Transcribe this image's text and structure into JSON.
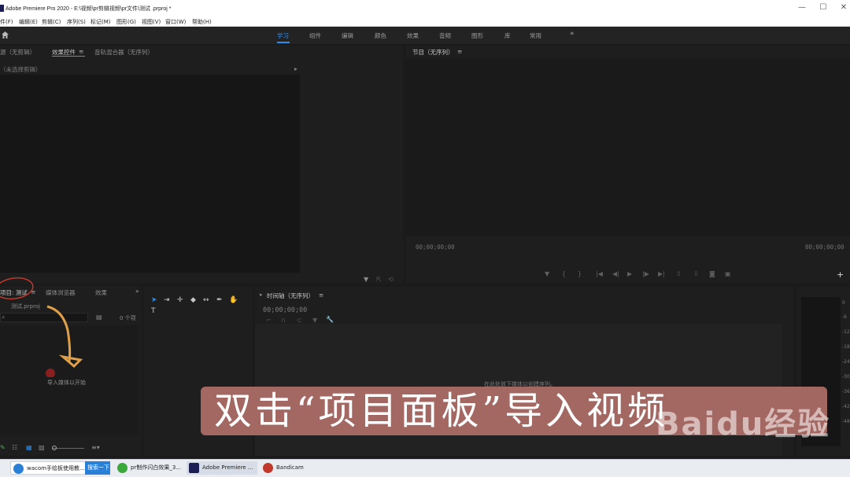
{
  "window": {
    "title": "Adobe Premiere Pro 2020 - E:\\视频\\pr剪辑视频\\pr文件\\测试 .prproj *",
    "controls": [
      "—",
      "☐",
      "✕"
    ]
  },
  "menu": [
    "件(F)",
    "编辑(E)",
    "剪辑(C)",
    "序列(S)",
    "标记(M)",
    "图形(G)",
    "视图(V)",
    "窗口(W)",
    "帮助(H)"
  ],
  "workspaces": {
    "tabs": [
      "学习",
      "组件",
      "编辑",
      "颜色",
      "效果",
      "音频",
      "图形",
      "库",
      "常用"
    ],
    "active": "学习",
    "more": "»"
  },
  "source_panel": {
    "tabs": [
      "源（无剪辑）",
      "效果控件",
      "音轨混合器（无序列）"
    ],
    "active_tab": "效果控件",
    "menu_icon": "≡",
    "message": "（未选择剪辑）",
    "arrow": "▸"
  },
  "program_panel": {
    "title": "节目（无序列）",
    "menu_icon": "≡",
    "timecode_left": "00;00;00;00",
    "timecode_right": "00;00;00;00",
    "add_button": "+"
  },
  "project_panel": {
    "tabs": [
      "项目: 测试",
      "媒体浏览器",
      "效果"
    ],
    "active_tab": "项目: 测试",
    "menu_icon": "≡",
    "more": "»",
    "file_name": "测试.prproj",
    "item_count": "0 个项",
    "import_hint": "导入媒体以开始"
  },
  "timeline_panel": {
    "title": "时间轴（无序列）",
    "menu_icon": "≡",
    "timecode": "00;00;00;00",
    "drop_hint": "在此处放下媒体以创建序列。"
  },
  "meter": {
    "labels": [
      "0",
      "-6",
      "-12",
      "-18",
      "-24",
      "-30",
      "-36",
      "-42",
      "-48"
    ]
  },
  "caption": {
    "text": "双击“项目面板”导入视频"
  },
  "watermark": {
    "text": "Baidu经验"
  },
  "taskbar": {
    "items": [
      {
        "label": "wacom手绘板使用教...",
        "icon_color": "#2a7fd6"
      },
      {
        "label": "搜索一下",
        "icon_color": "#2a7fd6"
      },
      {
        "label": "pr制作闪白效果_3...",
        "icon_color": "#3aa83a"
      },
      {
        "label": "Adobe Premiere ...",
        "icon_color": "#1c1e54"
      },
      {
        "label": "Bandicam",
        "icon_color": "#c0392b"
      }
    ]
  },
  "colors": {
    "accent": "#2d8ceb",
    "caption_bg": "#ae6e68",
    "annotation": "#e0a04a",
    "annotation_circle": "#c0392b"
  }
}
